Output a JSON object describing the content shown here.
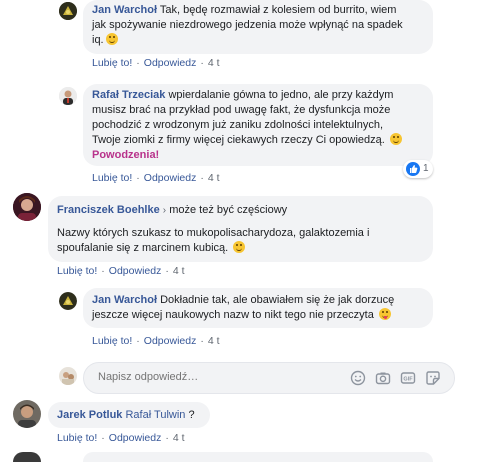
{
  "comments": [
    {
      "author": "Jan Warchoł",
      "lines": [
        "Tak, będę rozmawiał z kolesiem od burrito, wiem",
        "jak spożywanie niezdrowego jedzenia może wpłynąć na spadek",
        "iq."
      ],
      "actions": {
        "like": "Lubię to!",
        "reply": "Odpowiedz",
        "time": "4 t"
      }
    },
    {
      "author": "Rafał Trzeciak",
      "first_line_rest": "wpierdalanie gówna to jedno, ale przy każdym",
      "lines": [
        "musisz brać na przykład pod uwagę fakt, że dysfunkcja może",
        "pochodzić z wrodzonym już zaniku zdolności intelektulnych,",
        "Twoje ziomki z firmy więcej ciekawych rzeczy Ci opowiedzą."
      ],
      "highlight": "Powodzenia!",
      "reaction_count": "1",
      "actions": {
        "like": "Lubię to!",
        "reply": "Odpowiedz",
        "time": "4 t"
      }
    },
    {
      "author": "Franciszek Boehlke",
      "reply_to": "może też być częściowy",
      "lines": [
        "Nazwy których szukasz to mukopolisacharydoza, galaktozemia i",
        "spoufalanie się z marcinem kubicą."
      ],
      "actions": {
        "like": "Lubię to!",
        "reply": "Odpowiedz",
        "time": "4 t"
      }
    },
    {
      "author": "Jan Warchoł",
      "first_line_rest": "Dokładnie tak, ale obawiałem się że jak dorzucę",
      "lines": [
        "jeszcze więcej naukowych nazw to nikt tego nie przeczyta"
      ],
      "actions": {
        "like": "Lubię to!",
        "reply": "Odpowiedz",
        "time": "4 t"
      }
    },
    {
      "author": "Jarek Potluk",
      "mention": "Rafał Tulwin",
      "rest": "?",
      "actions": {
        "like": "Lubię to!",
        "reply": "Odpowiedz",
        "time": "4 t"
      }
    }
  ],
  "reply_box": {
    "placeholder": "Napisz odpowiedź…"
  },
  "icons": [
    "smiley-icon",
    "camera-icon",
    "gif-icon",
    "sticker-icon",
    "like-reaction-icon",
    "chevron-right-icon"
  ],
  "colors": {
    "link": "#385898",
    "bubble": "#f2f3f5",
    "highlight": "#b8328b",
    "like_blue": "#1877f2"
  }
}
